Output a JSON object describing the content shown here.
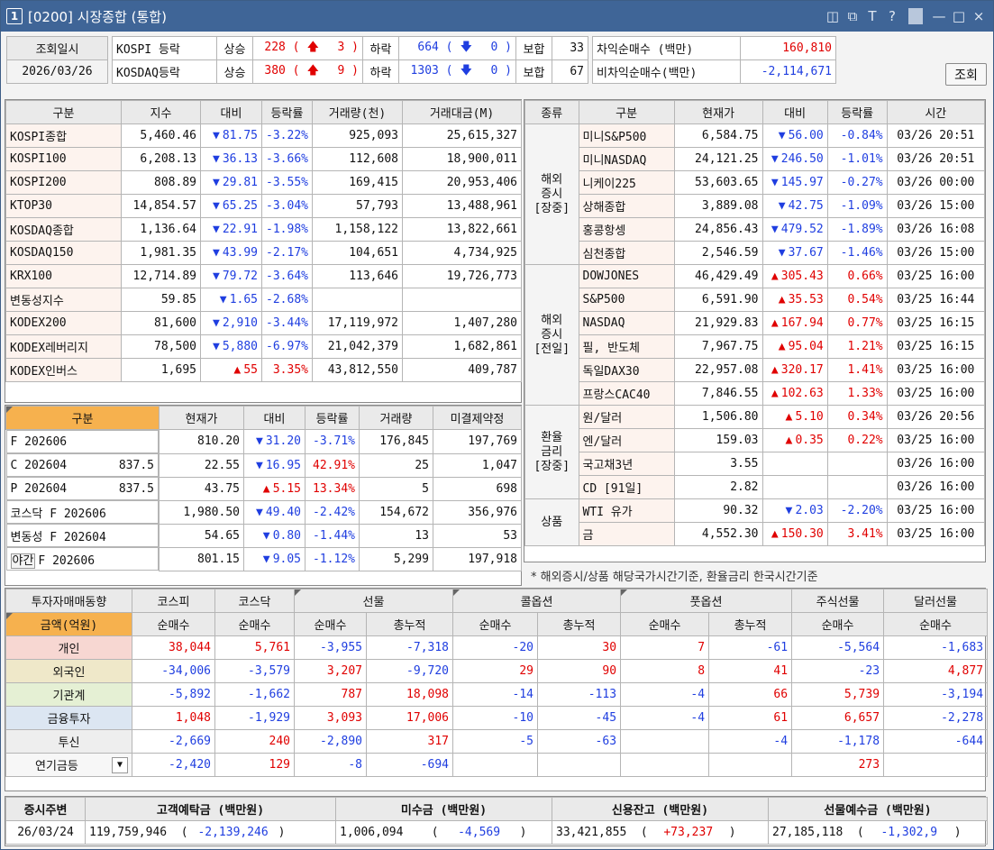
{
  "window": {
    "number": "1",
    "title": "[0200] 시장종합 (통합)",
    "buttons": [
      "◫",
      "⧉",
      "T",
      "?",
      "—",
      "□",
      "×"
    ]
  },
  "top": {
    "date_label": "조회일시",
    "date_value": "2026/03/26",
    "kospi": {
      "name": "KOSPI 등락",
      "up_label": "상승",
      "up": "228",
      "up_limit": "3",
      "down_label": "하락",
      "down": "664",
      "down_limit": "0",
      "flat_label": "보합",
      "flat": "33"
    },
    "kosdaq": {
      "name": "KOSDAQ등락",
      "up_label": "상승",
      "up": "380",
      "up_limit": "9",
      "down_label": "하락",
      "down": "1303",
      "down_limit": "0",
      "flat_label": "보합",
      "flat": "67"
    },
    "arb": {
      "label": "차익순매수 (백만)",
      "value": "160,810"
    },
    "nonarb": {
      "label": "비차익순매수(백만)",
      "value": "-2,114,671"
    },
    "search_button": "조회"
  },
  "index": {
    "headers": [
      "구분",
      "지수",
      "대비",
      "등락률",
      "거래량(천)",
      "거래대금(M)"
    ],
    "rows": [
      {
        "name": "KOSPI종합",
        "value": "5,460.46",
        "dir": "down",
        "chg": "81.75",
        "rate": "-3.22%",
        "vol": "925,093",
        "amt": "25,615,327"
      },
      {
        "name": "KOSPI100",
        "value": "6,208.13",
        "dir": "down",
        "chg": "36.13",
        "rate": "-3.66%",
        "vol": "112,608",
        "amt": "18,900,011"
      },
      {
        "name": "KOSPI200",
        "value": "808.89",
        "dir": "down",
        "chg": "29.81",
        "rate": "-3.55%",
        "vol": "169,415",
        "amt": "20,953,406"
      },
      {
        "name": "KTOP30",
        "value": "14,854.57",
        "dir": "down",
        "chg": "65.25",
        "rate": "-3.04%",
        "vol": "57,793",
        "amt": "13,488,961"
      },
      {
        "name": "KOSDAQ종합",
        "value": "1,136.64",
        "dir": "down",
        "chg": "22.91",
        "rate": "-1.98%",
        "vol": "1,158,122",
        "amt": "13,822,661"
      },
      {
        "name": "KOSDAQ150",
        "value": "1,981.35",
        "dir": "down",
        "chg": "43.99",
        "rate": "-2.17%",
        "vol": "104,651",
        "amt": "4,734,925"
      },
      {
        "name": "KRX100",
        "value": "12,714.89",
        "dir": "down",
        "chg": "79.72",
        "rate": "-3.64%",
        "vol": "113,646",
        "amt": "19,726,773"
      },
      {
        "name": "변동성지수",
        "value": "59.85",
        "dir": "down",
        "chg": "1.65",
        "rate": "-2.68%",
        "vol": "",
        "amt": ""
      },
      {
        "name": "KODEX200",
        "value": "81,600",
        "dir": "down",
        "chg": "2,910",
        "rate": "-3.44%",
        "vol": "17,119,972",
        "amt": "1,407,280"
      },
      {
        "name": "KODEX레버리지",
        "value": "78,500",
        "dir": "down",
        "chg": "5,880",
        "rate": "-6.97%",
        "vol": "21,042,379",
        "amt": "1,682,861"
      },
      {
        "name": "KODEX인버스",
        "value": "1,695",
        "dir": "up",
        "chg": "55",
        "rate": "3.35%",
        "vol": "43,812,550",
        "amt": "409,787"
      }
    ]
  },
  "deriv": {
    "headers": [
      "구분",
      "현재가",
      "대비",
      "등락률",
      "거래량",
      "미결제약정"
    ],
    "rows": [
      {
        "name": "F 202606",
        "strike": "",
        "value": "810.20",
        "dir": "down",
        "chg": "31.20",
        "rate": "-3.71%",
        "vol": "176,845",
        "oi": "197,769"
      },
      {
        "name": "C 202604",
        "strike": "837.5",
        "value": "22.55",
        "dir": "down",
        "chg": "16.95",
        "rate": "42.91%",
        "vol": "25",
        "oi": "1,047"
      },
      {
        "name": "P 202604",
        "strike": "837.5",
        "value": "43.75",
        "dir": "up",
        "chg": "5.15",
        "rate": "13.34%",
        "vol": "5",
        "oi": "698"
      },
      {
        "name": "코스닥 F 202606",
        "strike": "",
        "value": "1,980.50",
        "dir": "down",
        "chg": "49.40",
        "rate": "-2.42%",
        "vol": "154,672",
        "oi": "356,976"
      },
      {
        "name": "변동성 F 202604",
        "strike": "",
        "value": "54.65",
        "dir": "down",
        "chg": "0.80",
        "rate": "-1.44%",
        "vol": "13",
        "oi": "53"
      },
      {
        "name": "F 202606",
        "prefix": "야간",
        "strike": "",
        "value": "801.15",
        "dir": "down",
        "chg": "9.05",
        "rate": "-1.12%",
        "vol": "5,299",
        "oi": "197,918"
      }
    ]
  },
  "world": {
    "headers": [
      "종류",
      "구분",
      "현재가",
      "대비",
      "등락률",
      "시간"
    ],
    "groups": [
      {
        "label": "해외\n증시\n[장중]",
        "rows": [
          {
            "name": "미니S&P500",
            "value": "6,584.75",
            "dir": "down",
            "chg": "56.00",
            "rate": "-0.84%",
            "time": "03/26 20:51"
          },
          {
            "name": "미니NASDAQ",
            "value": "24,121.25",
            "dir": "down",
            "chg": "246.50",
            "rate": "-1.01%",
            "time": "03/26 20:51"
          },
          {
            "name": "니케이225",
            "value": "53,603.65",
            "dir": "down",
            "chg": "145.97",
            "rate": "-0.27%",
            "time": "03/26 00:00"
          },
          {
            "name": "상해종합",
            "value": "3,889.08",
            "dir": "down",
            "chg": "42.75",
            "rate": "-1.09%",
            "time": "03/26 15:00"
          },
          {
            "name": "홍콩항셍",
            "value": "24,856.43",
            "dir": "down",
            "chg": "479.52",
            "rate": "-1.89%",
            "time": "03/26 16:08"
          },
          {
            "name": "심천종합",
            "value": "2,546.59",
            "dir": "down",
            "chg": "37.67",
            "rate": "-1.46%",
            "time": "03/26 15:00"
          }
        ]
      },
      {
        "label": "해외\n증시\n[전일]",
        "rows": [
          {
            "name": "DOWJONES",
            "value": "46,429.49",
            "dir": "up",
            "chg": "305.43",
            "rate": "0.66%",
            "time": "03/25 16:00"
          },
          {
            "name": "S&P500",
            "value": "6,591.90",
            "dir": "up",
            "chg": "35.53",
            "rate": "0.54%",
            "time": "03/25 16:44"
          },
          {
            "name": "NASDAQ",
            "value": "21,929.83",
            "dir": "up",
            "chg": "167.94",
            "rate": "0.77%",
            "time": "03/25 16:15"
          },
          {
            "name": "필, 반도체",
            "value": "7,967.75",
            "dir": "up",
            "chg": "95.04",
            "rate": "1.21%",
            "time": "03/25 16:15"
          },
          {
            "name": "독일DAX30",
            "value": "22,957.08",
            "dir": "up",
            "chg": "320.17",
            "rate": "1.41%",
            "time": "03/25 16:00"
          },
          {
            "name": "프랑스CAC40",
            "value": "7,846.55",
            "dir": "up",
            "chg": "102.63",
            "rate": "1.33%",
            "time": "03/25 16:00"
          }
        ]
      },
      {
        "label": "환율\n금리\n[장중]",
        "rows": [
          {
            "name": "원/달러",
            "value": "1,506.80",
            "dir": "up",
            "chg": "5.10",
            "rate": "0.34%",
            "time": "03/26 20:56"
          },
          {
            "name": "엔/달러",
            "value": "159.03",
            "dir": "up",
            "chg": "0.35",
            "rate": "0.22%",
            "time": "03/25 16:00"
          },
          {
            "name": "국고채3년",
            "value": "3.55",
            "dir": "",
            "chg": "",
            "rate": "",
            "time": "03/26 16:00"
          },
          {
            "name": "CD [91일]",
            "value": "2.82",
            "dir": "",
            "chg": "",
            "rate": "",
            "time": "03/26 16:00"
          }
        ]
      },
      {
        "label": "상품",
        "rows": [
          {
            "name": "WTI 유가",
            "value": "90.32",
            "dir": "down",
            "chg": "2.03",
            "rate": "-2.20%",
            "time": "03/25 16:00"
          },
          {
            "name": "금",
            "value": "4,552.30",
            "dir": "up",
            "chg": "150.30",
            "rate": "3.41%",
            "time": "03/25 16:00"
          }
        ]
      }
    ],
    "note": "* 해외증시/상품 해당국가시간기준, 환율금리 한국시간기준"
  },
  "investor": {
    "title": "투자자매매동향",
    "unit": "금액(억원)",
    "groups": [
      "코스피",
      "코스닥",
      "선물",
      "콜옵션",
      "풋옵션",
      "주식선물",
      "달러선물"
    ],
    "sub": [
      "순매수",
      "순매수",
      "순매수",
      "총누적",
      "순매수",
      "총누적",
      "순매수",
      "총누적",
      "순매수",
      "순매수"
    ],
    "rows": [
      {
        "name": "개인",
        "vals": [
          "38,044",
          "5,761",
          "-3,955",
          "-7,318",
          "-20",
          "30",
          "7",
          "-61",
          "-5,564",
          "-1,683"
        ]
      },
      {
        "name": "외국인",
        "vals": [
          "-34,006",
          "-3,579",
          "3,207",
          "-9,720",
          "29",
          "90",
          "8",
          "41",
          "-23",
          "4,877"
        ]
      },
      {
        "name": "기관계",
        "vals": [
          "-5,892",
          "-1,662",
          "787",
          "18,098",
          "-14",
          "-113",
          "-4",
          "66",
          "5,739",
          "-3,194"
        ]
      },
      {
        "name": "금융투자",
        "vals": [
          "1,048",
          "-1,929",
          "3,093",
          "17,006",
          "-10",
          "-45",
          "-4",
          "61",
          "6,657",
          "-2,278"
        ]
      },
      {
        "name": "투신",
        "vals": [
          "-2,669",
          "240",
          "-2,890",
          "317",
          "-5",
          "-63",
          "",
          "-4",
          "-1,178",
          "-644"
        ]
      },
      {
        "name": "연기금등",
        "vals": [
          "-2,420",
          "129",
          "-8",
          "-694",
          "",
          "",
          "",
          "",
          "273",
          ""
        ]
      }
    ]
  },
  "funds": {
    "headers": [
      "증시주변",
      "고객예탁금 (백만원)",
      "미수금 (백만원)",
      "신용잔고 (백만원)",
      "선물예수금 (백만원)"
    ],
    "date": "26/03/24",
    "deposit": "119,759,946",
    "deposit_chg": "-2,139,246",
    "receivable": "1,006,094",
    "receivable_chg": "-4,569",
    "credit": "33,421,855",
    "credit_chg": "+73,237",
    "futures": "27,185,118",
    "futures_chg": "-1,302,9"
  }
}
